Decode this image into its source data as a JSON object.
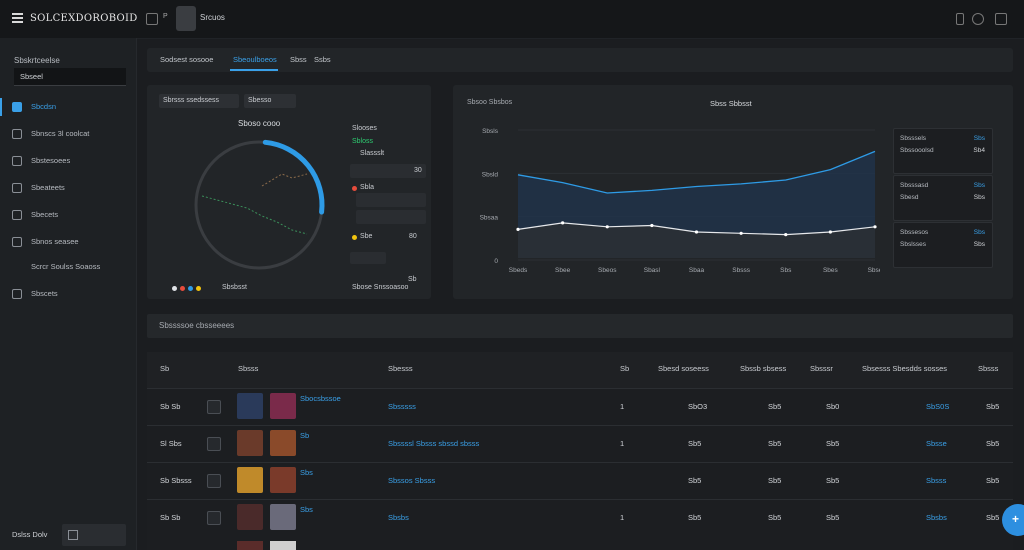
{
  "app": {
    "brand": "SOLCEXDOROBOID",
    "window_title": "Srcuos",
    "tab_badge": "P"
  },
  "topbar": {
    "icons": [
      "grid-icon",
      "settings-icon",
      "close-icon"
    ]
  },
  "sidebar": {
    "heading": "Sbskrtceelse",
    "search_value": "Sbseel",
    "items": [
      {
        "label": "Sbcdsn",
        "icon": "dashboard-icon",
        "active": true
      },
      {
        "label": "Sbnscs 3l coolcat",
        "icon": "shield-icon",
        "active": false
      },
      {
        "label": "Sbstesoees",
        "icon": "users-icon",
        "active": false
      },
      {
        "label": "Sbeateets",
        "icon": "chart-icon",
        "active": false
      },
      {
        "label": "Sbecets",
        "icon": "folder-icon",
        "active": false
      },
      {
        "label": "Sbnos seasee",
        "icon": "layers-icon",
        "active": false
      },
      {
        "label": "Scrcr Soulss Soaoss",
        "icon": "",
        "active": false
      },
      {
        "label": "Sbscets",
        "icon": "gear-icon",
        "active": false
      }
    ],
    "footer": "Dslss Dolv"
  },
  "tabs": [
    {
      "label": "Sodsest sosooe",
      "active": false
    },
    {
      "label": "Sbeoulboeos",
      "active": true
    },
    {
      "label": "Sbss",
      "active": false
    },
    {
      "label": "Ssbs",
      "active": false
    }
  ],
  "left_panel": {
    "pills": [
      "Sbrsss ssedssess",
      "Sbesso"
    ],
    "gauge_title": "Sboso cooo",
    "gauge_value": 0.42,
    "legend": [
      {
        "label": "Slooses",
        "color": "#888888"
      },
      {
        "label": "Sbloss",
        "color": "#2ecc71"
      },
      {
        "label": "Slassslt",
        "color": "#888888"
      },
      {
        "label": "Sbla",
        "color": "#e74c3c"
      },
      {
        "label": "Sbe",
        "color": "#f1c40f"
      }
    ],
    "values": [
      "Sb",
      "30",
      "Sbo",
      "80",
      "Sbelp"
    ],
    "footer_left": "Sbsbsst",
    "footer_right": "Sbose Snssoasoo",
    "footer_num": "Sb"
  },
  "right_panel": {
    "header_left": "Sbsoo Sbsbos",
    "title": "Sbss Sbbsst",
    "y_ticks": [
      "Sbsls",
      "Sbsld",
      "Sbsaa",
      "0"
    ],
    "x_ticks": [
      "Sbeds",
      "Sbee",
      "Sbeos",
      "Sbasl",
      "Sbaa",
      "Sbsss",
      "Sbs",
      "Sbes",
      "Sbse"
    ],
    "cards": [
      {
        "l1": "Sbsssels",
        "l2": "Sbssooolsd",
        "v1": "Sbs",
        "v2": "Sb4"
      },
      {
        "l1": "Sbsssasd",
        "l2": "Sbesd",
        "v1": "Sbs",
        "v2": "Sbs"
      },
      {
        "l1": "Sbssesos",
        "l2": "Sbslsses",
        "v1": "Sbs",
        "v2": "Sbs"
      }
    ]
  },
  "chart_data": {
    "type": "line",
    "title": "Sbss Sbbsst",
    "x": [
      "Sbeds",
      "Sbee",
      "Sbeos",
      "Sbasl",
      "Sbaa",
      "Sbsss",
      "Sbs",
      "Sbes",
      "Sbse"
    ],
    "series": [
      {
        "values": [
          64,
          58,
          50,
          52,
          55,
          57,
          60,
          68,
          82
        ]
      },
      {
        "values": [
          22,
          27,
          24,
          25,
          20,
          19,
          18,
          20,
          24
        ]
      }
    ],
    "ylim": [
      0,
      100
    ]
  },
  "section": {
    "title": "Sbssssoe cbsseeees"
  },
  "table": {
    "headers": [
      "Sb",
      "Sbsss",
      "Sbesss",
      "Sb",
      "Sbesd soseess",
      "Sbssb sbsess",
      "Sbsssr",
      "Sbsesss Sbesdds sosses",
      "Sbsss"
    ],
    "rows": [
      {
        "id": "Sb Sb",
        "name": "Sbocsbssoe",
        "desc": "Sbsssss",
        "n": "1",
        "a": "SbO3",
        "b": "Sb5",
        "c": "Sb0",
        "status": "SbS0S",
        "e": "Sb5"
      },
      {
        "id": "Sl Sbs",
        "name": "Sb",
        "desc": "Sbssssl Sbsss sbssd sbsss",
        "n": "1",
        "a": "Sb5",
        "b": "Sb5",
        "c": "Sb5",
        "status": "Sbsse",
        "e": "Sb5"
      },
      {
        "id": "Sb Sbsss",
        "name": "Sbs",
        "desc": "Sbssos Sbsss",
        "n": "",
        "a": "Sb5",
        "b": "Sb5",
        "c": "Sb5",
        "status": "Sbsss",
        "e": "Sb5"
      },
      {
        "id": "Sb Sb",
        "name": "Sbs",
        "desc": "Sbsbs",
        "n": "1",
        "a": "Sb5",
        "b": "Sb5",
        "c": "Sb5",
        "status": "Sbsbs",
        "e": "Sb5"
      }
    ]
  },
  "colors": {
    "accent": "#3aa0e8",
    "bg": "#1b1d20",
    "panel": "#222528"
  }
}
